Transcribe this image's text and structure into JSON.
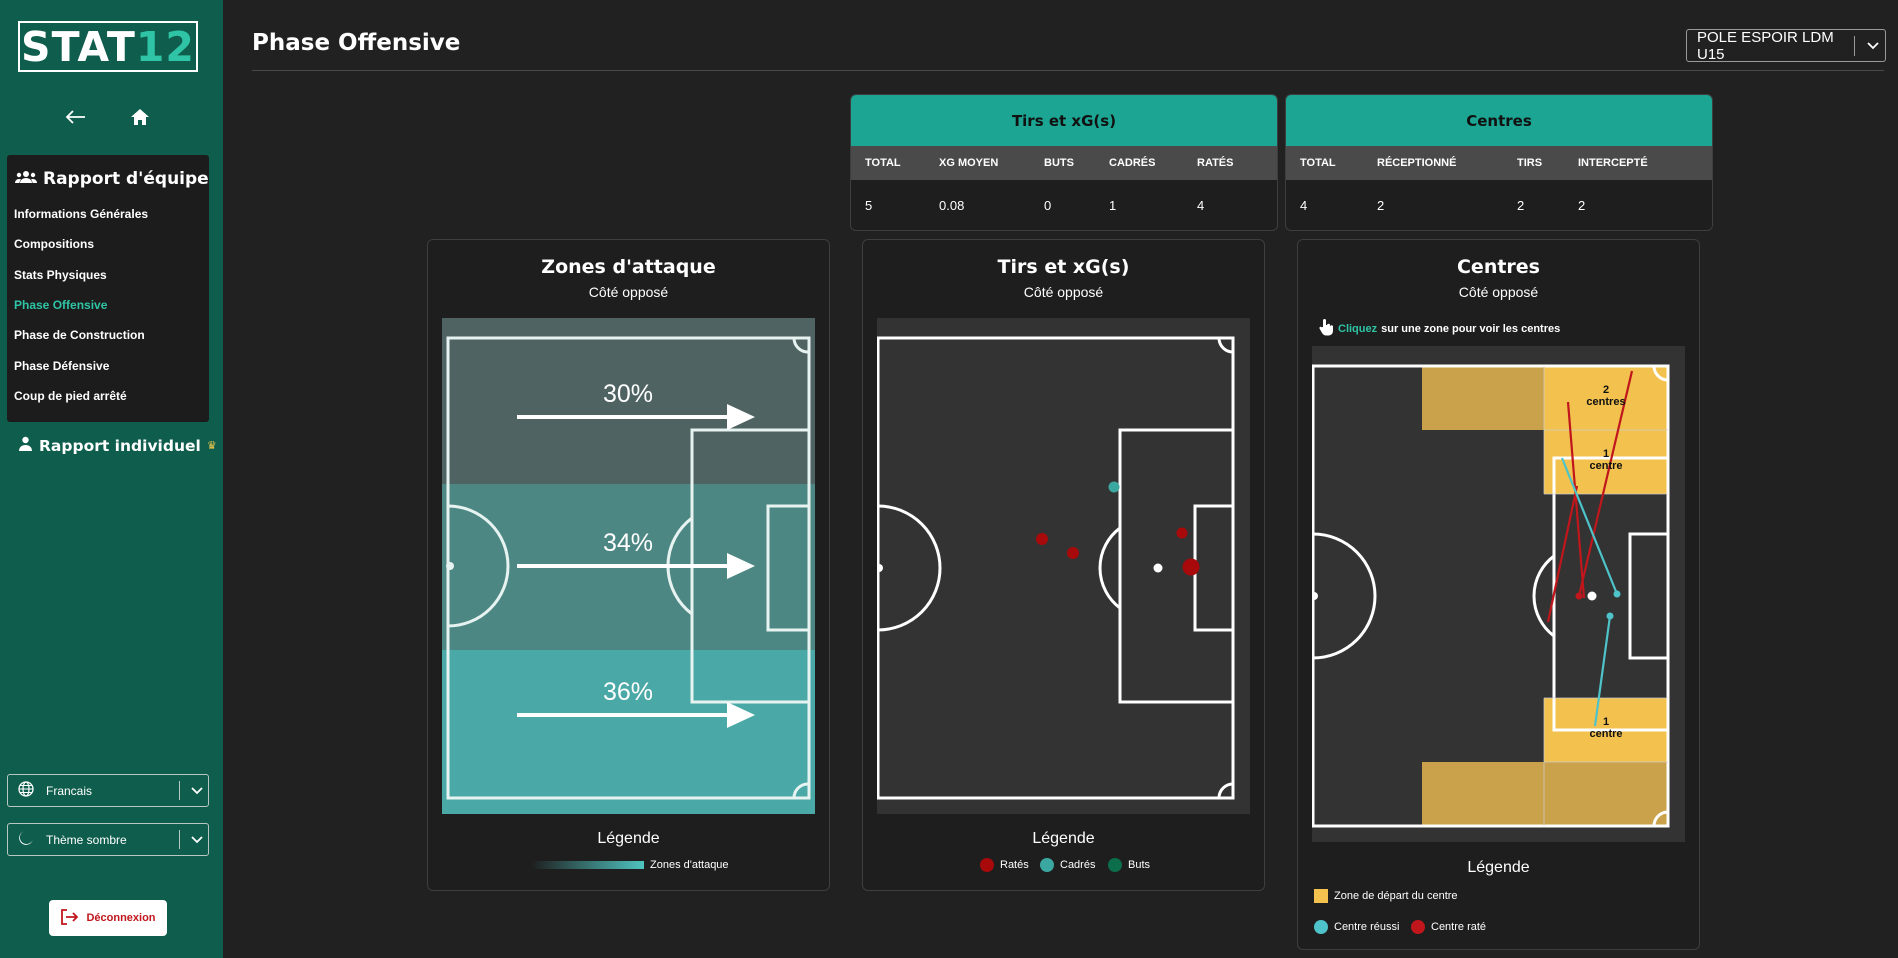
{
  "sidebar": {
    "logo_white": "STAT",
    "logo_green": "12",
    "menu_title": "Rapport d'équipe",
    "menu_items": [
      {
        "label": "Informations Générales"
      },
      {
        "label": "Compositions"
      },
      {
        "label": "Stats Physiques"
      },
      {
        "label": "Phase Offensive",
        "active": true
      },
      {
        "label": "Phase de Construction"
      },
      {
        "label": "Phase Défensive"
      },
      {
        "label": "Coup de pied arrêté"
      }
    ],
    "individual_label": "Rapport individuel",
    "language": "Francais",
    "theme": "Thème sombre",
    "logout": "Déconnexion"
  },
  "header": {
    "title": "Phase Offensive",
    "team": "POLE ESPOIR LDM U15"
  },
  "tables": {
    "tirs": {
      "title": "Tirs et xG(s)",
      "columns": [
        "TOTAL",
        "XG MOYEN",
        "BUTS",
        "CADRÉS",
        "RATÉS"
      ],
      "values": [
        "5",
        "0.08",
        "0",
        "1",
        "4"
      ]
    },
    "centres": {
      "title": "Centres",
      "columns": [
        "TOTAL",
        "RÉCEPTIONNÉ",
        "TIRS",
        "INTERCEPTÉ"
      ],
      "values": [
        "4",
        "2",
        "2",
        "2"
      ]
    }
  },
  "zones": {
    "title": "Zones d'attaque",
    "subtitle": "Côté opposé",
    "percentages": [
      "30%",
      "34%",
      "36%"
    ],
    "legend_title": "Légende",
    "legend_label": "Zones d'attaque"
  },
  "shots": {
    "title": "Tirs et xG(s)",
    "subtitle": "Côté opposé",
    "legend_title": "Légende",
    "legend": [
      "Ratés",
      "Cadrés",
      "Buts"
    ],
    "colors": {
      "missed": "#a8090b",
      "on_target": "#3aa8a0",
      "goals": "#0c6e4a"
    }
  },
  "crosses": {
    "title": "Centres",
    "subtitle": "Côté opposé",
    "hint_link": "Cliquez",
    "hint_rest": "sur une zone pour voir les centres",
    "zone_labels": [
      {
        "count": "2",
        "label": "centres"
      },
      {
        "count": "1",
        "label": "centre"
      },
      {
        "count": "1",
        "label": "centre"
      }
    ],
    "legend_title": "Légende",
    "legend_zone": "Zone de départ du centre",
    "legend_success": "Centre réussi",
    "legend_fail": "Centre raté",
    "colors": {
      "zone": "#f2c14e",
      "success": "#4ec3c9",
      "fail": "#c0161c"
    }
  }
}
